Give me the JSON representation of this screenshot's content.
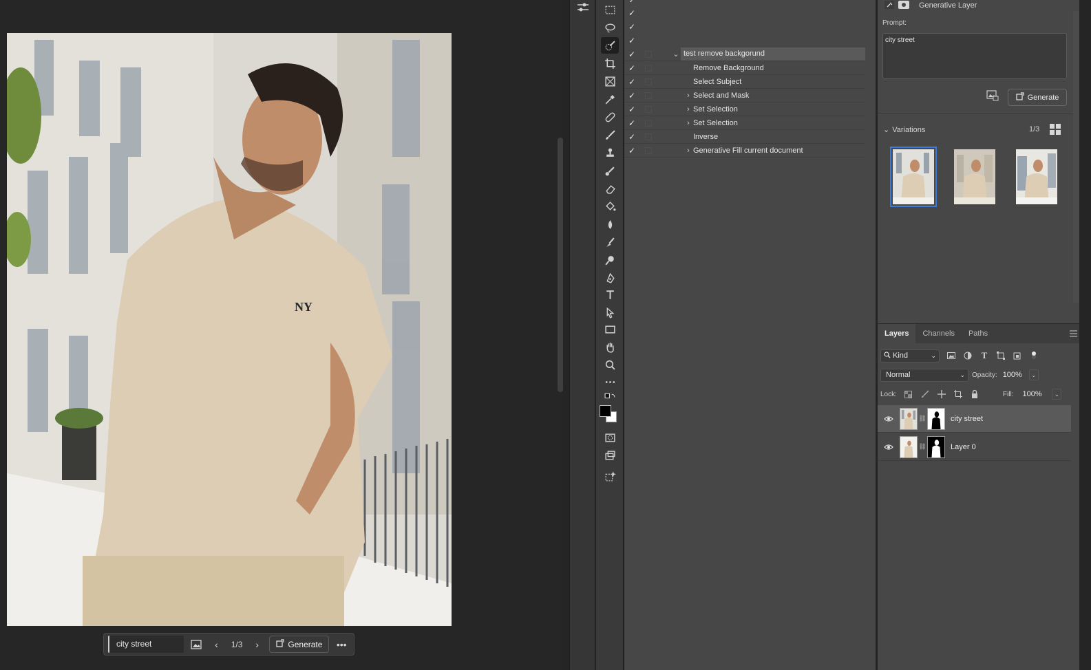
{
  "canvas": {
    "context_bar": {
      "prompt": "city street",
      "variation_count": "1/3",
      "generate_label": "Generate"
    }
  },
  "actions_panel": {
    "rows": [
      {
        "label": "test remove backgorund",
        "expanded": true
      },
      {
        "label": "Remove Background"
      },
      {
        "label": "Select Subject"
      },
      {
        "label": "Select and Mask",
        "has_children": true
      },
      {
        "label": "Set Selection",
        "has_children": true
      },
      {
        "label": "Set Selection",
        "has_children": true
      },
      {
        "label": "Inverse"
      },
      {
        "label": "Generative Fill current document",
        "has_children": true
      }
    ]
  },
  "properties": {
    "title": "Generative Layer",
    "prompt_label": "Prompt:",
    "prompt_value": "city street",
    "generate_label": "Generate",
    "variations_label": "Variations",
    "variations_count": "1/3",
    "selected_variation": 0
  },
  "layers": {
    "tabs": [
      "Layers",
      "Channels",
      "Paths"
    ],
    "active_tab": "Layers",
    "filter_kind": "Kind",
    "blend_mode": "Normal",
    "opacity_label": "Opacity:",
    "opacity": "100%",
    "lock_label": "Lock:",
    "fill_label": "Fill:",
    "fill": "100%",
    "items": [
      {
        "name": "city street",
        "selected": true
      },
      {
        "name": "Layer 0",
        "selected": false
      }
    ]
  },
  "colors": {
    "selection_accent": "#3a7bdc",
    "panel_bg": "#474747",
    "shirt": "#dccdb4"
  }
}
